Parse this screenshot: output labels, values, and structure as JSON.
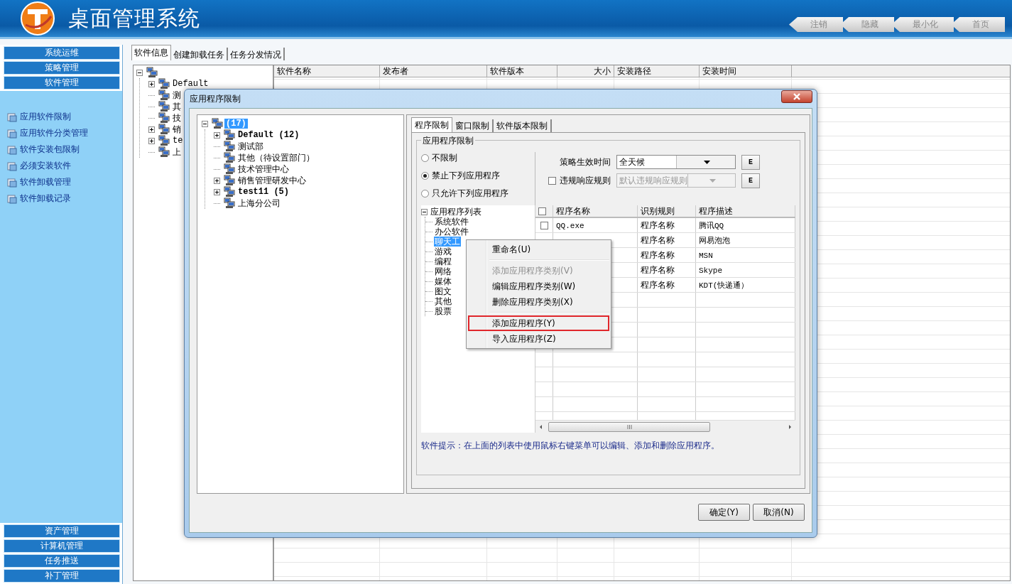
{
  "header": {
    "title": "桌面管理系统",
    "buttons": [
      "注销",
      "隐藏",
      "最小化",
      "首页"
    ]
  },
  "sidebar": {
    "top_sections": [
      "系统运维",
      "策略管理",
      "软件管理"
    ],
    "items": [
      {
        "label": "应用软件限制"
      },
      {
        "label": "应用软件分类管理"
      },
      {
        "label": "软件安装包限制"
      },
      {
        "label": "必须安装软件"
      },
      {
        "label": "软件卸载管理"
      },
      {
        "label": "软件卸载记录"
      }
    ],
    "bottom_sections": [
      "资产管理",
      "计算机管理",
      "任务推送",
      "补丁管理"
    ]
  },
  "main": {
    "tabs": [
      {
        "label": "软件信息",
        "selected": true
      },
      {
        "label": "创建卸载任务",
        "selected": false
      },
      {
        "label": "任务分发情况",
        "selected": false
      }
    ],
    "tree": [
      {
        "expandable": true,
        "expanded": true,
        "children": [
          {
            "label": "Default",
            "expandable": true,
            "expanded": false
          },
          {
            "label": "测",
            "expandable": false
          },
          {
            "label": "其",
            "expandable": false
          },
          {
            "label": "技",
            "expandable": false
          },
          {
            "label": "销",
            "expandable": true,
            "expanded": false
          },
          {
            "label": "te",
            "expandable": true,
            "expanded": false
          },
          {
            "label": "上",
            "expandable": false
          }
        ]
      }
    ],
    "table": {
      "columns": [
        "软件名称",
        "发布者",
        "软件版本",
        "大小",
        "安装路径",
        "安装时间"
      ]
    }
  },
  "dialog": {
    "title": "应用程序限制",
    "tree": [
      {
        "label": "(17)",
        "expandable": true,
        "expanded": true,
        "selected": true,
        "bold": true,
        "children": [
          {
            "label": "Default (12)",
            "expandable": true,
            "expanded": false,
            "selected": false,
            "bold": true
          },
          {
            "label": "测试部",
            "expandable": false,
            "selected": false,
            "bold": false
          },
          {
            "label": "其他（待设置部门）",
            "expandable": false,
            "selected": false,
            "bold": false
          },
          {
            "label": "技术管理中心",
            "expandable": false,
            "selected": false,
            "bold": false
          },
          {
            "label": "销售管理研发中心",
            "expandable": true,
            "expanded": false,
            "selected": false,
            "bold": false
          },
          {
            "label": "test11 (5)",
            "expandable": true,
            "expanded": false,
            "selected": false,
            "bold": true
          },
          {
            "label": "上海分公司",
            "expandable": false,
            "selected": false,
            "bold": false
          }
        ]
      }
    ],
    "tabs": [
      {
        "label": "程序限制",
        "selected": true
      },
      {
        "label": "窗口限制",
        "selected": false
      },
      {
        "label": "软件版本限制",
        "selected": false
      }
    ],
    "group_title": "应用程序限制",
    "radios": [
      {
        "label": "不限制",
        "selected": false
      },
      {
        "label": "禁止下列应用程序",
        "selected": true
      },
      {
        "label": "只允许下列应用程序",
        "selected": false
      }
    ],
    "schedule": {
      "label": "策略生效时间",
      "value": "全天候",
      "button": "E"
    },
    "violation": {
      "label": "违规响应规则",
      "checked": false,
      "value": "默认违规响应规则",
      "disabled": true,
      "button": "E"
    },
    "app_tree": {
      "label": "应用程序列表",
      "expandable": true,
      "expanded": true,
      "children": [
        {
          "label": "系统软件",
          "selected": false
        },
        {
          "label": "办公软件",
          "selected": false
        },
        {
          "label": "聊天工",
          "selected": true
        },
        {
          "label": "游戏",
          "selected": false
        },
        {
          "label": "编程",
          "selected": false
        },
        {
          "label": "网络",
          "selected": false
        },
        {
          "label": "媒体",
          "selected": false
        },
        {
          "label": "图文",
          "selected": false
        },
        {
          "label": "其他",
          "selected": false
        },
        {
          "label": "股票",
          "selected": false
        }
      ]
    },
    "app_table": {
      "all_checked": false,
      "columns": [
        "程序名称",
        "识别规则",
        "程序描述"
      ],
      "rows": [
        {
          "checked": false,
          "name": "QQ.exe",
          "rule": "程序名称",
          "description": "腾讯QQ"
        },
        {
          "rule": "程序名称",
          "description": "网易泡泡"
        },
        {
          "rule": "程序名称",
          "description": "MSN"
        },
        {
          "rule": "程序名称",
          "description": "Skype"
        },
        {
          "rule": "程序名称",
          "description": "KDT(快递通）"
        }
      ]
    },
    "hint": "软件提示：在上面的列表中使用鼠标右键菜单可以编辑、添加和删除应用程序。",
    "buttons": [
      "确定(Y)",
      "取消(N)"
    ]
  },
  "context_menu": [
    {
      "kind": "item",
      "label": "重命名(U)",
      "disabled": false,
      "highlighted": false
    },
    {
      "kind": "separator"
    },
    {
      "kind": "item",
      "label": "添加应用程序类别(V)",
      "disabled": true,
      "highlighted": false
    },
    {
      "kind": "item",
      "label": "编辑应用程序类别(W)",
      "disabled": false,
      "highlighted": false
    },
    {
      "kind": "item",
      "label": "删除应用程序类别(X)",
      "disabled": false,
      "highlighted": false
    },
    {
      "kind": "separator"
    },
    {
      "kind": "item",
      "label": "添加应用程序(Y)",
      "disabled": false,
      "highlighted": true
    },
    {
      "kind": "item",
      "label": "导入应用程序(Z)",
      "disabled": false,
      "highlighted": false
    }
  ]
}
